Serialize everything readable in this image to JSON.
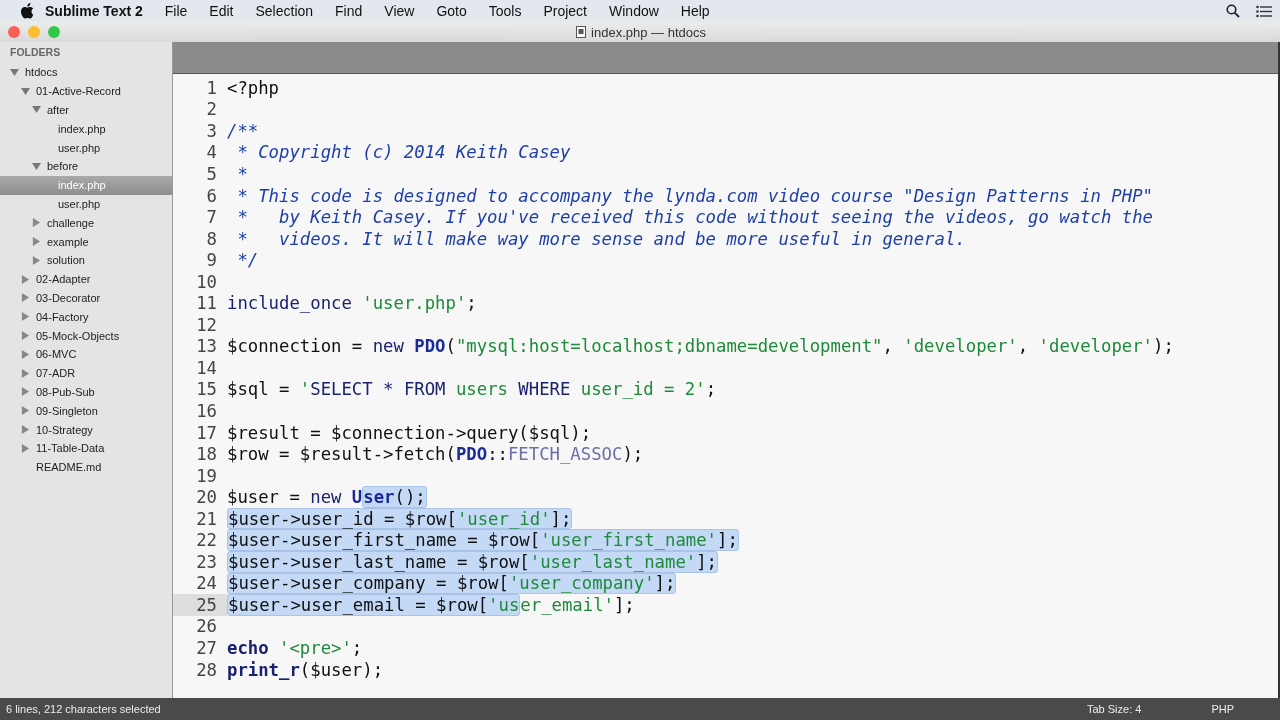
{
  "menu_bar": {
    "app": "Sublime Text 2",
    "items": [
      "File",
      "Edit",
      "Selection",
      "Find",
      "View",
      "Goto",
      "Tools",
      "Project",
      "Window",
      "Help"
    ]
  },
  "window": {
    "title": "index.php — htdocs"
  },
  "sidebar": {
    "header": "FOLDERS",
    "items": [
      {
        "label": "htdocs",
        "kind": "folder",
        "expanded": true,
        "selected": false,
        "children": [
          {
            "label": "01-Active-Record",
            "kind": "folder",
            "expanded": true,
            "selected": false,
            "children": [
              {
                "label": "after",
                "kind": "folder",
                "expanded": true,
                "selected": false,
                "children": [
                  {
                    "label": "index.php",
                    "kind": "file",
                    "selected": false
                  },
                  {
                    "label": "user.php",
                    "kind": "file",
                    "selected": false
                  }
                ]
              },
              {
                "label": "before",
                "kind": "folder",
                "expanded": true,
                "selected": false,
                "children": [
                  {
                    "label": "index.php",
                    "kind": "file",
                    "selected": true
                  },
                  {
                    "label": "user.php",
                    "kind": "file",
                    "selected": false
                  }
                ]
              },
              {
                "label": "challenge",
                "kind": "folder",
                "expanded": false,
                "selected": false
              },
              {
                "label": "example",
                "kind": "folder",
                "expanded": false,
                "selected": false
              },
              {
                "label": "solution",
                "kind": "folder",
                "expanded": false,
                "selected": false
              }
            ]
          },
          {
            "label": "02-Adapter",
            "kind": "folder",
            "expanded": false,
            "selected": false
          },
          {
            "label": "03-Decorator",
            "kind": "folder",
            "expanded": false,
            "selected": false
          },
          {
            "label": "04-Factory",
            "kind": "folder",
            "expanded": false,
            "selected": false
          },
          {
            "label": "05-Mock-Objects",
            "kind": "folder",
            "expanded": false,
            "selected": false
          },
          {
            "label": "06-MVC",
            "kind": "folder",
            "expanded": false,
            "selected": false
          },
          {
            "label": "07-ADR",
            "kind": "folder",
            "expanded": false,
            "selected": false
          },
          {
            "label": "08-Pub-Sub",
            "kind": "folder",
            "expanded": false,
            "selected": false
          },
          {
            "label": "09-Singleton",
            "kind": "folder",
            "expanded": false,
            "selected": false
          },
          {
            "label": "10-Strategy",
            "kind": "folder",
            "expanded": false,
            "selected": false
          },
          {
            "label": "11-Table-Data",
            "kind": "folder",
            "expanded": false,
            "selected": false
          },
          {
            "label": "README.md",
            "kind": "file",
            "selected": false
          }
        ]
      }
    ]
  },
  "editor": {
    "lines": [
      {
        "number": "1",
        "current": false,
        "pre": [
          {
            "text": "<?php",
            "kind": "plain"
          }
        ]
      },
      {
        "number": "2",
        "current": false
      },
      {
        "number": "3",
        "current": false,
        "pre": [
          {
            "text": "/**",
            "kind": "comment"
          }
        ]
      },
      {
        "number": "4",
        "current": false,
        "pre": [
          {
            "text": " * Copyright (c) 2014 Keith Casey",
            "kind": "comment"
          }
        ]
      },
      {
        "number": "5",
        "current": false,
        "pre": [
          {
            "text": " *",
            "kind": "comment"
          }
        ]
      },
      {
        "number": "6",
        "current": false,
        "pre": [
          {
            "text": " * This code is designed to accompany the lynda.com video course \"Design Patterns in PHP\"",
            "kind": "comment"
          }
        ]
      },
      {
        "number": "7",
        "current": false,
        "pre": [
          {
            "text": " *   by Keith Casey. If you've received this code without seeing the videos, go watch the",
            "kind": "comment"
          }
        ]
      },
      {
        "number": "8",
        "current": false,
        "pre": [
          {
            "text": " *   videos. It will make way more sense and be more useful in general.",
            "kind": "comment"
          }
        ]
      },
      {
        "number": "9",
        "current": false,
        "pre": [
          {
            "text": " */",
            "kind": "comment"
          }
        ]
      },
      {
        "number": "10",
        "current": false
      },
      {
        "number": "11",
        "current": false,
        "pre": [
          {
            "text": "include_once",
            "kind": "keyword"
          },
          {
            "text": " 'user.php'",
            "kind": "string"
          },
          {
            "text": ";",
            "kind": "plain"
          }
        ]
      },
      {
        "number": "12",
        "current": false
      },
      {
        "number": "13",
        "current": false,
        "pre": [
          {
            "text": "$connection = ",
            "kind": "plain"
          },
          {
            "text": "new",
            "kind": "keyword"
          },
          {
            "text": " PDO",
            "kind": "class"
          },
          {
            "text": "(",
            "kind": "plain"
          },
          {
            "text": "\"mysql:host=localhost;dbname=development\"",
            "kind": "string"
          },
          {
            "text": ", ",
            "kind": "plain"
          },
          {
            "text": "'developer'",
            "kind": "string"
          },
          {
            "text": ", ",
            "kind": "plain"
          },
          {
            "text": "'developer'",
            "kind": "string"
          },
          {
            "text": ");",
            "kind": "plain"
          }
        ]
      },
      {
        "number": "14",
        "current": false
      },
      {
        "number": "15",
        "current": false,
        "pre": [
          {
            "text": "$sql = ",
            "kind": "plain"
          },
          {
            "text": "'",
            "kind": "string"
          },
          {
            "text": "SELECT * FROM",
            "kind": "keyword"
          },
          {
            "text": " users ",
            "kind": "string"
          },
          {
            "text": "WHERE",
            "kind": "keyword"
          },
          {
            "text": " user_id = 2'",
            "kind": "string"
          },
          {
            "text": ";",
            "kind": "plain"
          }
        ]
      },
      {
        "number": "16",
        "current": false
      },
      {
        "number": "17",
        "current": false,
        "pre": [
          {
            "text": "$result = $connection->query($sql);",
            "kind": "plain"
          }
        ]
      },
      {
        "number": "18",
        "current": false,
        "pre": [
          {
            "text": "$row = $result->fetch(",
            "kind": "plain"
          },
          {
            "text": "PDO",
            "kind": "class"
          },
          {
            "text": "::",
            "kind": "plain"
          },
          {
            "text": "FETCH_ASSOC",
            "kind": "constant"
          },
          {
            "text": ");",
            "kind": "plain"
          }
        ]
      },
      {
        "number": "19",
        "current": false
      },
      {
        "number": "20",
        "current": false,
        "pre": [
          {
            "text": "$user = ",
            "kind": "plain"
          },
          {
            "text": "new",
            "kind": "keyword"
          },
          {
            "text": " U",
            "kind": "class"
          }
        ],
        "sel": [
          {
            "text": "ser",
            "kind": "class"
          },
          {
            "text": "();",
            "kind": "plain"
          }
        ]
      },
      {
        "number": "21",
        "current": false,
        "sel": [
          {
            "text": "$user->user_id = $row[",
            "kind": "plain"
          },
          {
            "text": "'user_id'",
            "kind": "string"
          },
          {
            "text": "];",
            "kind": "plain"
          }
        ]
      },
      {
        "number": "22",
        "current": false,
        "sel": [
          {
            "text": "$user->user_first_name = $row[",
            "kind": "plain"
          },
          {
            "text": "'user_first_name'",
            "kind": "string"
          },
          {
            "text": "];",
            "kind": "plain"
          }
        ]
      },
      {
        "number": "23",
        "current": false,
        "sel": [
          {
            "text": "$user->user_last_name = $row[",
            "kind": "plain"
          },
          {
            "text": "'user_last_name'",
            "kind": "string"
          },
          {
            "text": "];",
            "kind": "plain"
          }
        ]
      },
      {
        "number": "24",
        "current": false,
        "sel": [
          {
            "text": "$user->user_company = $row[",
            "kind": "plain"
          },
          {
            "text": "'user_company'",
            "kind": "string"
          },
          {
            "text": "];",
            "kind": "plain"
          }
        ]
      },
      {
        "number": "25",
        "current": true,
        "sel": [
          {
            "text": "$user->user_email = $row[",
            "kind": "plain"
          },
          {
            "text": "'us",
            "kind": "string"
          }
        ],
        "post": [
          {
            "text": "er_email'",
            "kind": "string"
          },
          {
            "text": "];",
            "kind": "plain"
          }
        ]
      },
      {
        "number": "26",
        "current": false
      },
      {
        "number": "27",
        "current": false,
        "pre": [
          {
            "text": "echo",
            "kind": "bold"
          },
          {
            "text": " '<pre>'",
            "kind": "string"
          },
          {
            "text": ";",
            "kind": "plain"
          }
        ]
      },
      {
        "number": "28",
        "current": false,
        "pre": [
          {
            "text": "print_r",
            "kind": "bold"
          },
          {
            "text": "($user);",
            "kind": "plain"
          }
        ]
      }
    ]
  },
  "status_bar": {
    "selection": "6 lines, 212 characters selected",
    "tab_size": "Tab Size: 4",
    "syntax": "PHP"
  }
}
